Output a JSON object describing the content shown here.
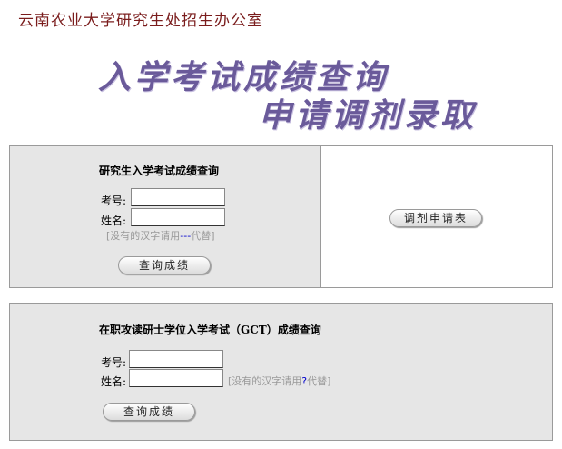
{
  "header": {
    "org_title": "云南农业大学研究生处招生办公室",
    "banner_line1": "入学考试成绩查询",
    "banner_line2": "申请调剂录取"
  },
  "exam_query": {
    "title": "研究生入学考试成绩查询",
    "exam_no_label": "考号:",
    "name_label": "姓名:",
    "exam_no_value": "",
    "name_value": "",
    "hint_prefix": "[没有的汉字请用",
    "hint_symbol": "---",
    "hint_suffix": "代替]",
    "query_button": "查询成绩"
  },
  "transfer": {
    "apply_button": "调剂申请表"
  },
  "gct_query": {
    "title": "在职攻读研士学位入学考试（GCT）成绩查询",
    "exam_no_label": "考号:",
    "name_label": "姓名:",
    "exam_no_value": "",
    "name_value": "",
    "hint_prefix": "[没有的汉字请用",
    "hint_symbol": "?",
    "hint_suffix": "代替]",
    "query_button": "查询成绩"
  }
}
